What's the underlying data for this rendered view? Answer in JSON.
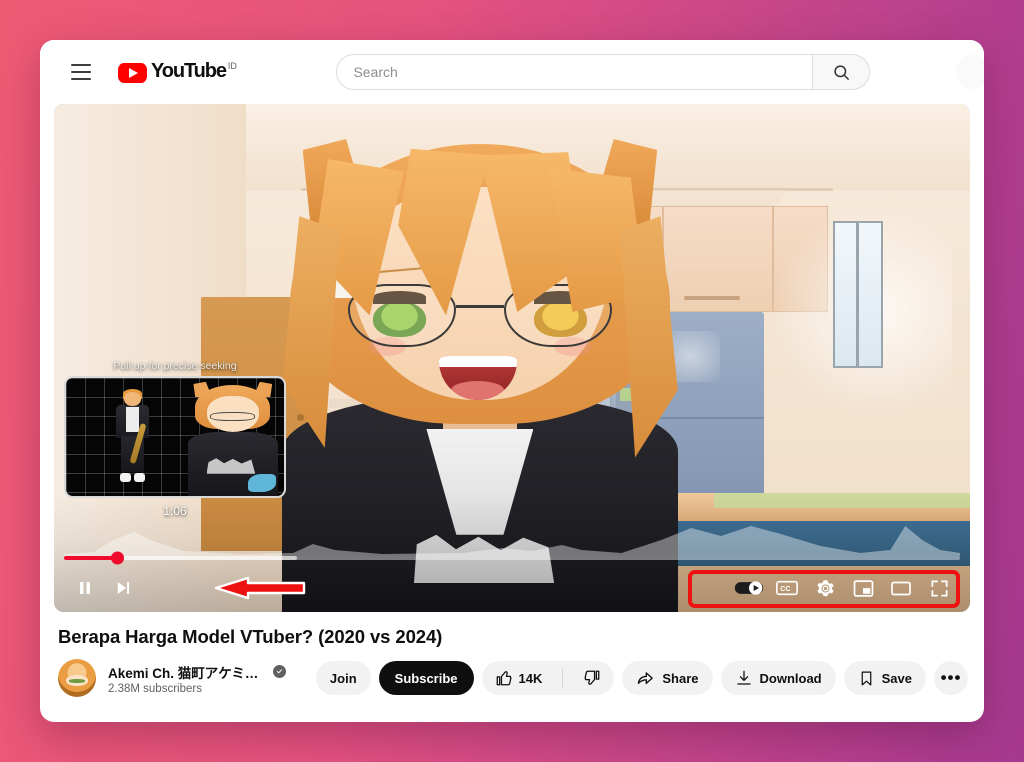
{
  "background": {
    "gradient_from": "#ef5a73",
    "gradient_to": "#a5398f"
  },
  "header": {
    "menu_icon": "hamburger-menu-icon",
    "logo_text": "YouTube",
    "logo_country_code": "ID",
    "logo_color": "#ff0000",
    "search": {
      "placeholder": "Search",
      "value": "",
      "icon": "search-icon"
    }
  },
  "player": {
    "seek_preview": {
      "hint": "Pull up for precise seeking",
      "timestamp": "1:06"
    },
    "progress": {
      "played_percent": 6,
      "buffered_percent": 26,
      "fill_color": "#f00b2e"
    },
    "controls_left": [
      {
        "name": "pause-button",
        "icon": "pause-icon",
        "label": "Pause"
      },
      {
        "name": "next-button",
        "icon": "next-track-icon",
        "label": "Next"
      }
    ],
    "controls_right": [
      {
        "name": "autoplay-toggle",
        "icon": "autoplay-toggle-icon",
        "label": "Autoplay",
        "state": "on"
      },
      {
        "name": "subtitles-button",
        "icon": "closed-captions-icon",
        "label": "Subtitles/CC"
      },
      {
        "name": "settings-button",
        "icon": "gear-icon",
        "label": "Settings"
      },
      {
        "name": "miniplayer-button",
        "icon": "miniplayer-icon",
        "label": "Miniplayer"
      },
      {
        "name": "theater-button",
        "icon": "theater-mode-icon",
        "label": "Theater mode"
      },
      {
        "name": "fullscreen-button",
        "icon": "fullscreen-icon",
        "label": "Full screen"
      }
    ],
    "annotations": {
      "arrow_color": "#ee1111",
      "highlight_color": "#ee1111"
    }
  },
  "video": {
    "title": "Berapa Harga Model VTuber? (2020 vs 2024)",
    "channel": {
      "name": "Akemi Ch. 猫町アケミ【AKA Virt…",
      "verified": true,
      "subscribers": "2.38M subscribers"
    },
    "actions": {
      "join": "Join",
      "subscribe": "Subscribe",
      "like_count": "14K",
      "share": "Share",
      "download": "Download",
      "save": "Save",
      "more": "•••"
    }
  }
}
